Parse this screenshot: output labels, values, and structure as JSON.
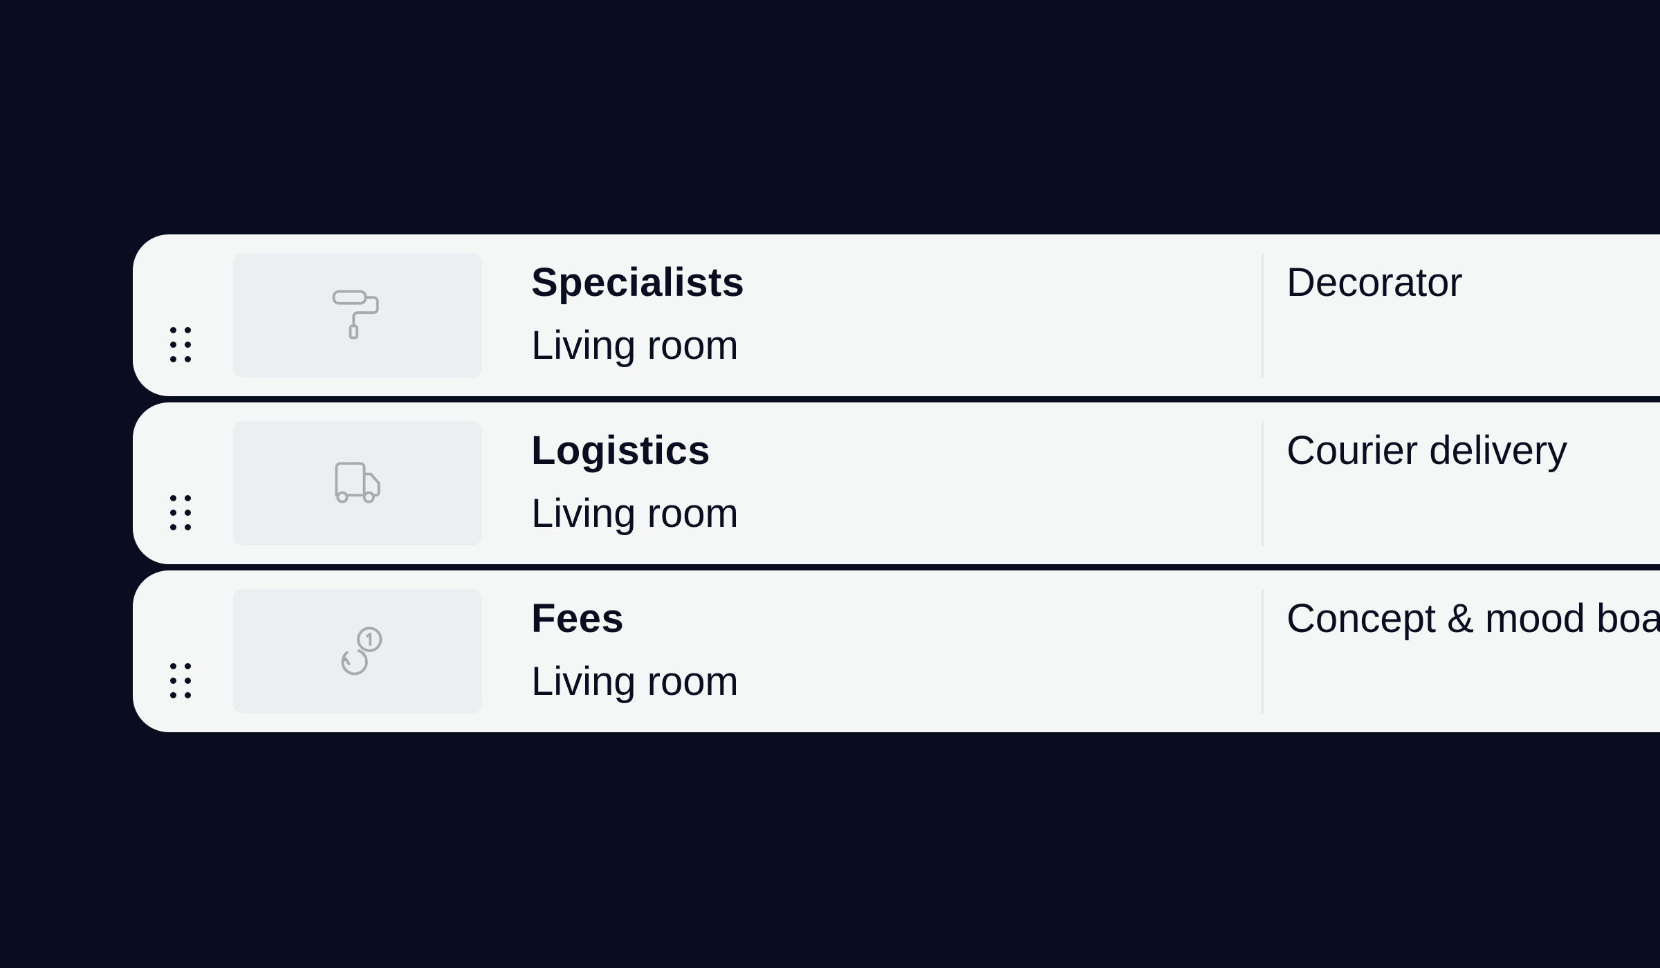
{
  "rows": [
    {
      "icon": "paint-roller-icon",
      "title": "Specialists",
      "subtitle": "Living room",
      "detail": "Decorator"
    },
    {
      "icon": "delivery-truck-icon",
      "title": "Logistics",
      "subtitle": "Living room",
      "detail": "Courier delivery"
    },
    {
      "icon": "coins-icon",
      "title": "Fees",
      "subtitle": "Living room",
      "detail": "Concept & mood board"
    }
  ],
  "colors": {
    "background": "#0a0c1f",
    "row_background": "#f5f6f6",
    "thumbnail_background": "#edeef1",
    "icon_stroke": "#a8aab0",
    "text": "#0a0c1f"
  }
}
